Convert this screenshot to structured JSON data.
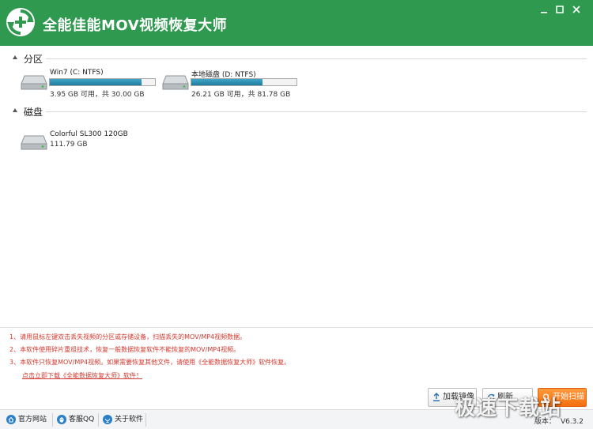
{
  "app": {
    "title": "全能佳能MOV视频恢复大师"
  },
  "window_controls": {
    "minimize_icon": "minimize-icon",
    "maximize_icon": "maximize-icon",
    "close_icon": "close-icon"
  },
  "partitions": {
    "title": "分区",
    "items": [
      {
        "name": "Win7 (C: NTFS)",
        "size": "3.95 GB 可用，共 30.00 GB",
        "used_fraction": 0.87
      },
      {
        "name": "本地磁盘 (D: NTFS)",
        "size": "26.21 GB 可用，共 81.78 GB",
        "used_fraction": 0.68
      }
    ]
  },
  "disks": {
    "title": "磁盘",
    "items": [
      {
        "name": "Colorful SL300 120GB",
        "size": "111.79 GB"
      }
    ]
  },
  "tips": [
    "1、请用鼠标左键双击丢失视频的分区或存储设备，扫描丢失的MOV/MP4视频数据。",
    "2、本软件使用碎片重组技术，恢复一般数据恢复软件不能恢复的MOV/MP4视频。",
    "3、本软件只恢复MOV/MP4视频。如果需要恢复其他文件，请使用《全能数据恢复大师》软件恢复。"
  ],
  "download_link": "点击立即下载《全能数据恢复大师》软件！",
  "buttons": {
    "load_image": "加载镜像",
    "refresh": "刷新",
    "start_scan": "开始扫描"
  },
  "statusbar": {
    "website": "官方网站",
    "support_qq": "客服QQ",
    "about": "关于软件",
    "version_label": "版本：",
    "version_value": "V6.3.2"
  },
  "watermark": "极速下载站",
  "colors": {
    "titlebar": "#2f9a4f",
    "accent": "#f46f10",
    "tip_text": "#d0392f",
    "progress": "#1f7d9f"
  }
}
